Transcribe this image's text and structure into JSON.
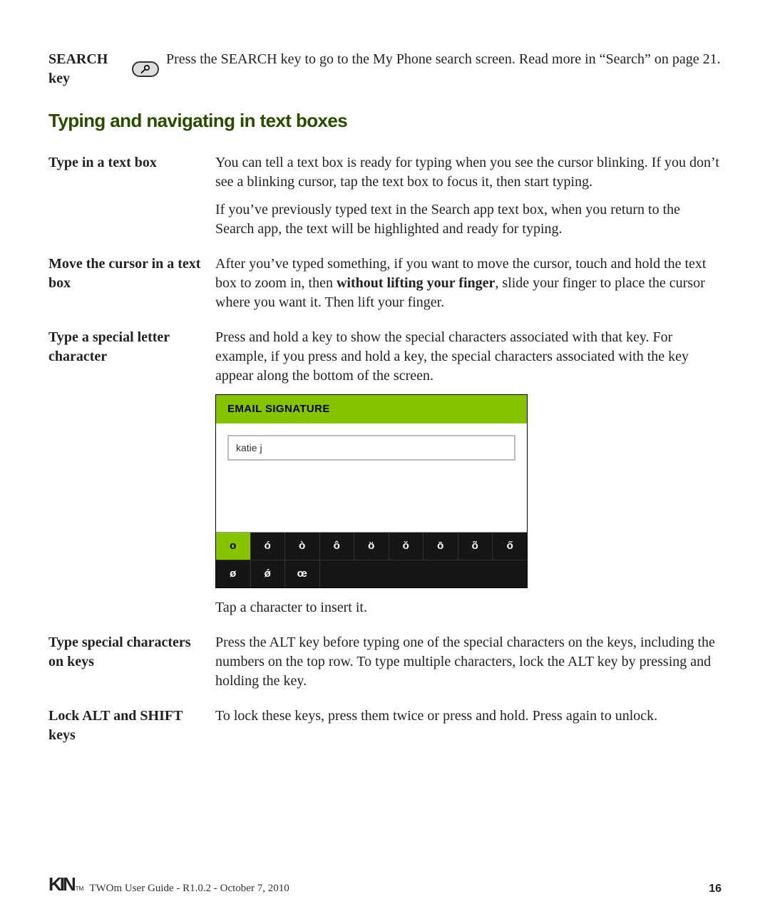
{
  "intro": {
    "label": "SEARCH key",
    "text": "Press the SEARCH key to go to the My Phone search screen. Read more in “Search” on page 21."
  },
  "section_heading": "Typing and navigating in text boxes",
  "rows": {
    "r1": {
      "term": "Type in a text box",
      "p1": "You can tell a text box is ready for typing when you see the cursor blinking. If you don’t see a blinking cursor, tap the text box to focus it, then start typing.",
      "p2": "If you’ve previously typed text in the Search app text box, when you return to the Search app, the text will be highlighted and ready for typing."
    },
    "r2": {
      "term": "Move the cursor in a text box",
      "p1_before": "After you’ve typed something, if you want to move the cursor, touch and hold the text box to zoom in, then ",
      "p1_strong": "without lifting your finger",
      "p1_after": ", slide your finger to place the cursor where you want it. Then lift your finger."
    },
    "r3": {
      "term": "Type a special letter character",
      "p1": "Press and hold a key to show the special characters associated with that key. For example, if you press and hold a key, the special characters associated with the key appear along the bottom of the screen.",
      "caption": "Tap a character to insert it."
    },
    "r4": {
      "term": "Type special characters on keys",
      "p1": "Press the ALT key before typing one of the special characters on the keys, including the numbers on the top row. To type multiple characters, lock the ALT key by pressing and holding the key."
    },
    "r5": {
      "term": "Lock ALT and SHIFT keys",
      "p1": "To lock these keys, press them twice or press and hold. Press again to unlock."
    }
  },
  "phonefig": {
    "header": "EMAIL SIGNATURE",
    "input_value": "katie j",
    "keys_row1": [
      "o",
      "ó",
      "ò",
      "ô",
      "ö",
      "ŏ",
      "ō",
      "õ",
      "ő"
    ],
    "keys_row2": [
      "ø",
      "ǿ",
      "œ"
    ]
  },
  "footer": {
    "logo": "KIN",
    "tm": "TM",
    "text": "TWOm User Guide - R1.0.2 - October 7, 2010",
    "page": "16"
  }
}
